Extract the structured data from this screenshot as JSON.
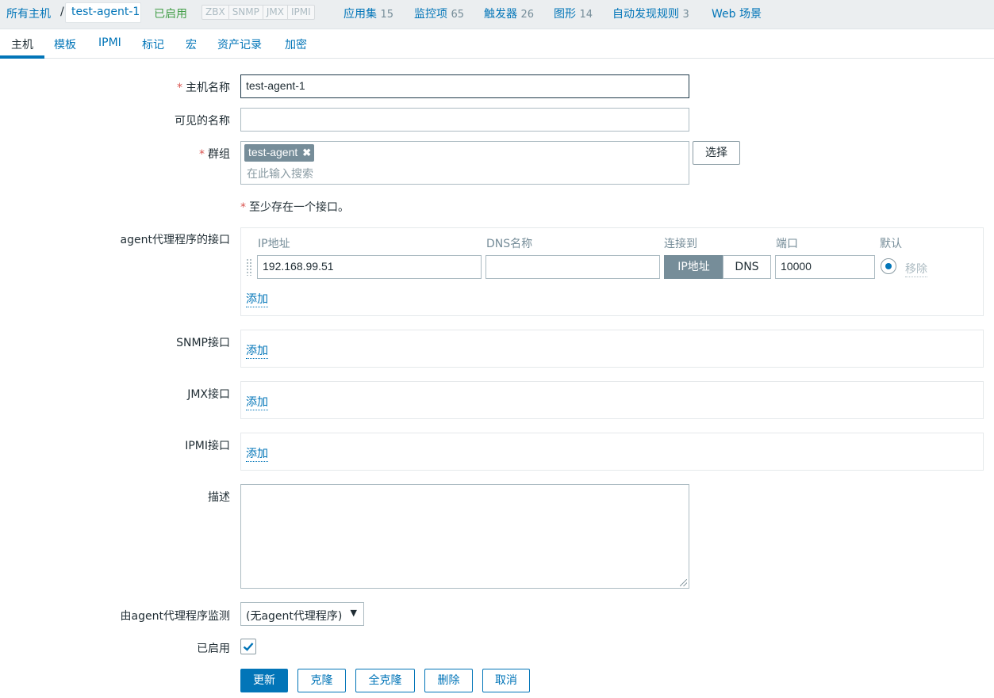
{
  "topbar": {
    "all_hosts": "所有主机",
    "separator": "/",
    "current_host": "test-agent-1",
    "status": "已启用",
    "availability": [
      "ZBX",
      "SNMP",
      "JMX",
      "IPMI"
    ],
    "links": [
      {
        "label": "应用集",
        "count": "15"
      },
      {
        "label": "监控项",
        "count": "65"
      },
      {
        "label": "触发器",
        "count": "26"
      },
      {
        "label": "图形",
        "count": "14"
      },
      {
        "label": "自动发现规则",
        "count": "3"
      },
      {
        "label": "Web 场景",
        "count": ""
      }
    ]
  },
  "tabs": [
    "主机",
    "模板",
    "IPMI",
    "标记",
    "宏",
    "资产记录",
    "加密"
  ],
  "form": {
    "host_name_label": "主机名称",
    "host_name_value": "test-agent-1",
    "visible_name_label": "可见的名称",
    "visible_name_value": "",
    "groups_label": "群组",
    "group_tag": "test-agent",
    "group_placeholder": "在此输入搜索",
    "select_button": "选择",
    "interface_note": "至少存在一个接口。",
    "agent_iface_label": "agent代理程序的接口",
    "columns": {
      "ip": "IP地址",
      "dns": "DNS名称",
      "connect": "连接到",
      "port": "端口",
      "default": "默认"
    },
    "agent_iface": {
      "ip": "192.168.99.51",
      "dns": "",
      "connect_ip": "IP地址",
      "connect_dns": "DNS",
      "port": "10000",
      "remove": "移除"
    },
    "add": "添加",
    "snmp_label": "SNMP接口",
    "jmx_label": "JMX接口",
    "ipmi_label": "IPMI接口",
    "description_label": "描述",
    "description_value": "",
    "proxy_label": "由agent代理程序监测",
    "proxy_value": "(无agent代理程序)",
    "enabled_label": "已启用",
    "enabled": true
  },
  "buttons": {
    "update": "更新",
    "clone": "克隆",
    "full_clone": "全克隆",
    "delete": "删除",
    "cancel": "取消"
  },
  "colors": {
    "accent": "#0275b8",
    "status_green": "#429e47",
    "required": "#d9534f"
  }
}
